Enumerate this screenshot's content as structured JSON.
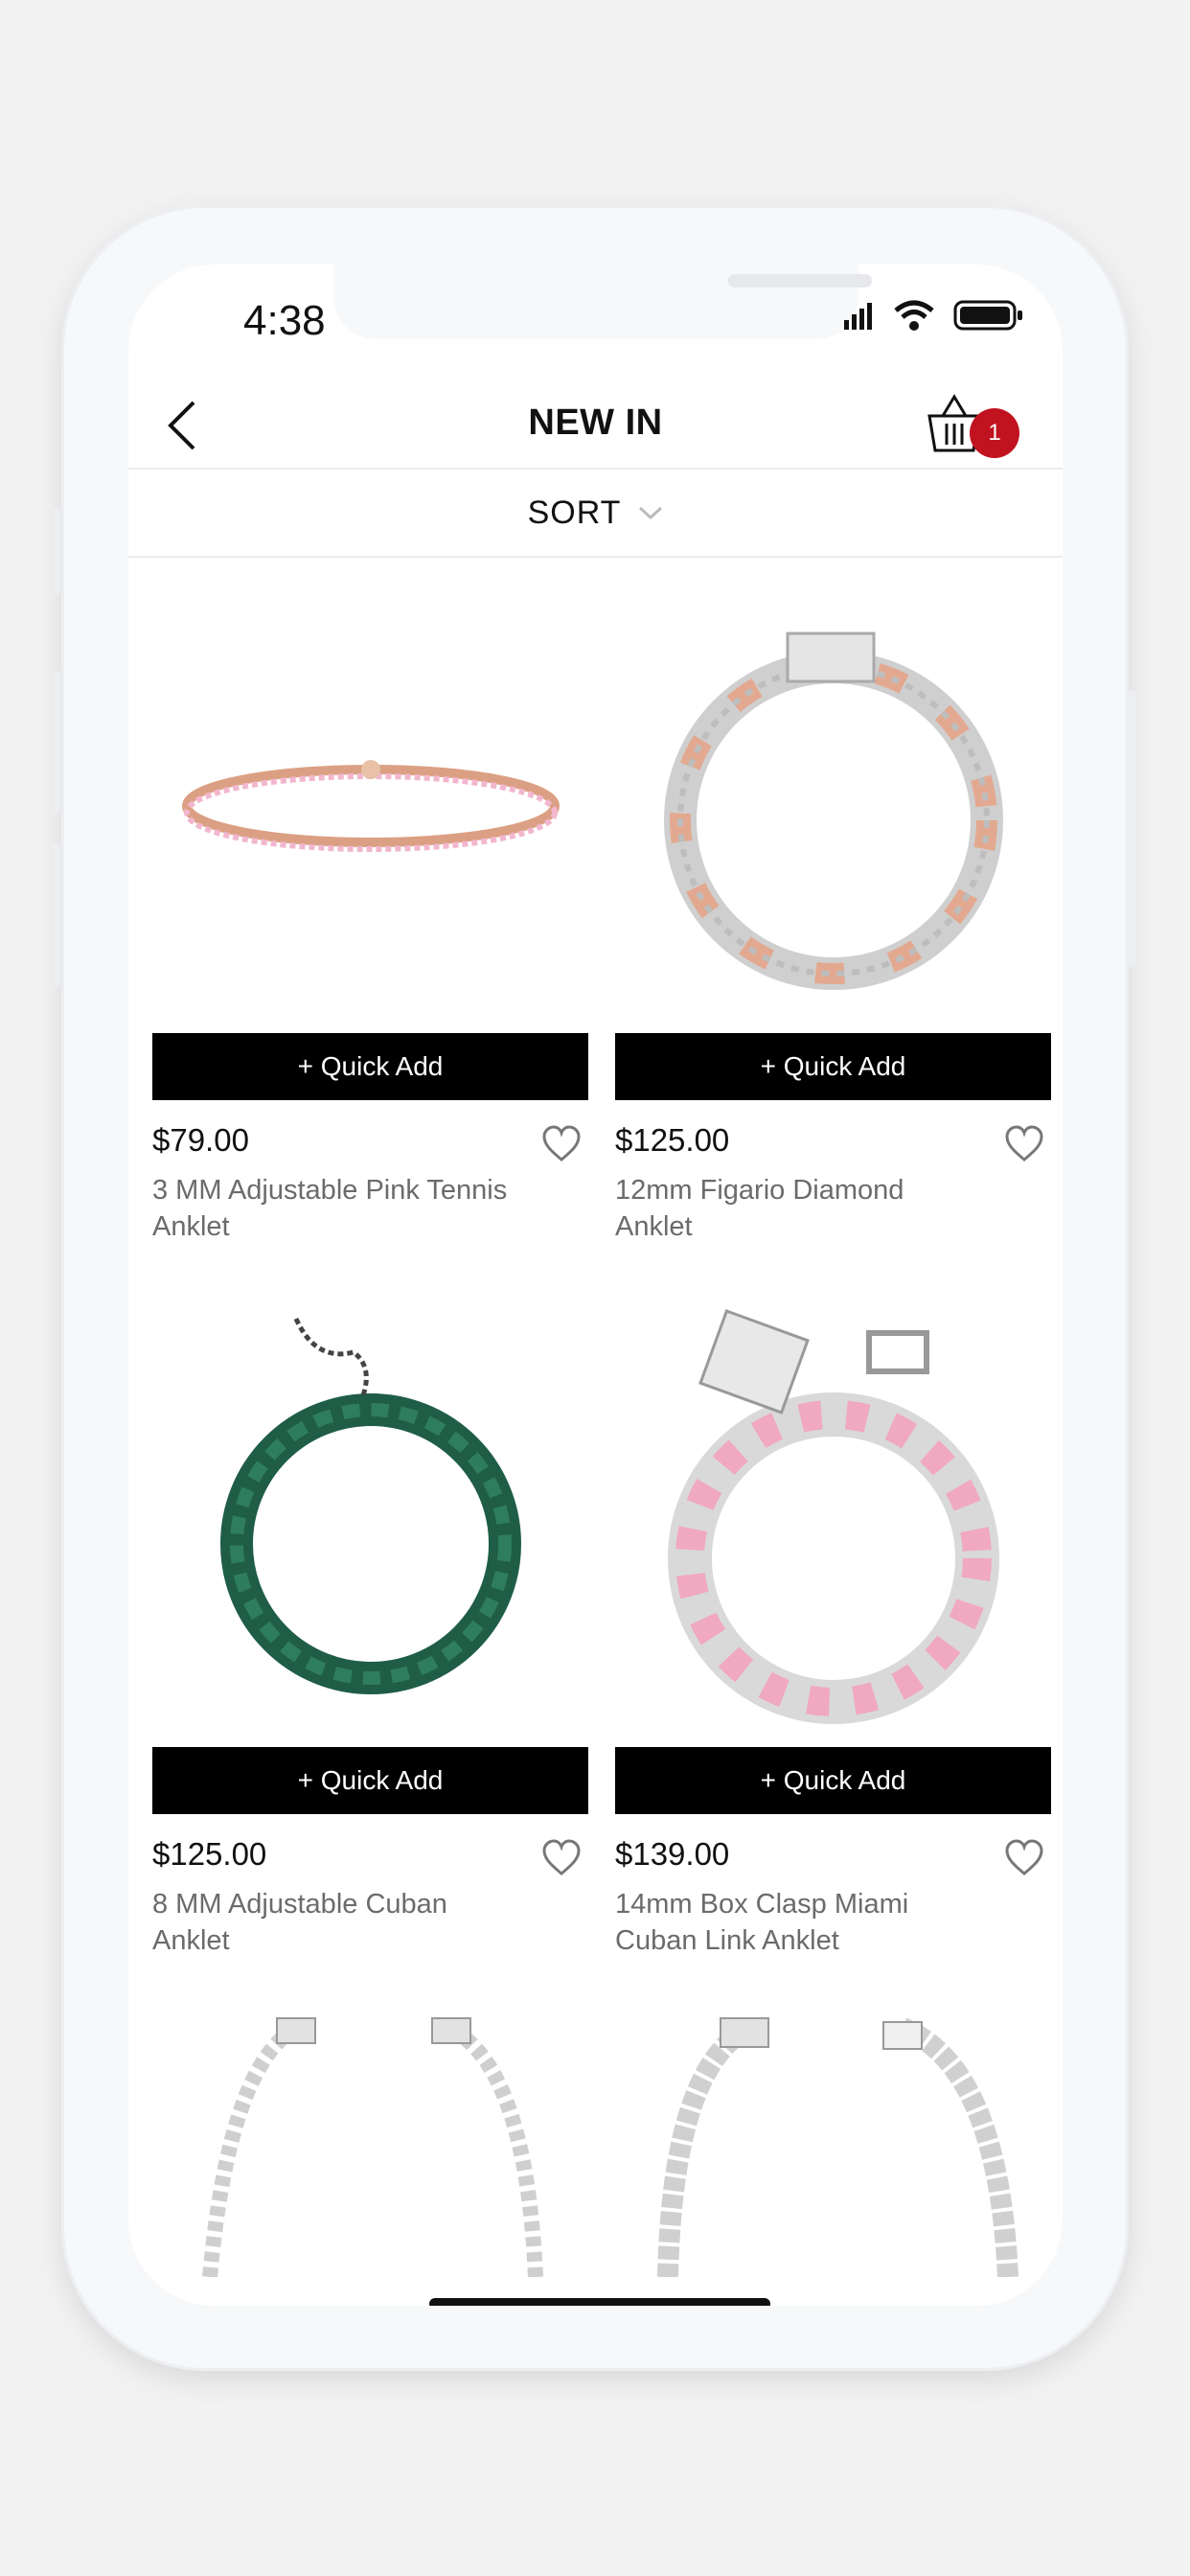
{
  "status_bar": {
    "time": "4:38"
  },
  "header": {
    "title": "NEW IN",
    "cart_count": "1"
  },
  "sort": {
    "label": "SORT"
  },
  "products": [
    {
      "price": "$79.00",
      "name": "3 MM Adjustable Pink Tennis Anklet",
      "quick_add": "+ Quick Add"
    },
    {
      "price": "$125.00",
      "name": "12mm Figario Diamond Anklet",
      "quick_add": "+ Quick Add"
    },
    {
      "price": "$125.00",
      "name": "8 MM Adjustable Cuban Anklet",
      "quick_add": "+ Quick Add"
    },
    {
      "price": "$139.00",
      "name": "14mm Box Clasp Miami Cuban Link Anklet",
      "quick_add": "+ Quick Add"
    }
  ],
  "colors": {
    "badge": "#c1121f",
    "button_bg": "#000000",
    "text_secondary": "#6b6b6b"
  },
  "icons": [
    "back-chevron-icon",
    "basket-icon",
    "chevron-down-icon",
    "heart-icon",
    "signal-icon",
    "wifi-icon",
    "battery-icon"
  ]
}
